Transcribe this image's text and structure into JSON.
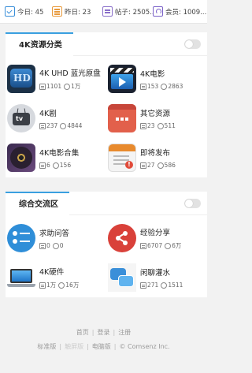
{
  "stats": {
    "today": "今日: 45",
    "yesterday": "昨日: 23",
    "posts": "帖子: 2505...",
    "members": "会员: 1009..."
  },
  "sections": [
    {
      "title": "4K资源分类",
      "items": [
        {
          "name": "4K UHD 蓝光原盘",
          "threads": "1101",
          "replies": "1万",
          "icon": "uhd-disc-icon"
        },
        {
          "name": "4K电影",
          "threads": "153",
          "replies": "2863",
          "icon": "clapperboard-icon"
        },
        {
          "name": "4K剧",
          "threads": "237",
          "replies": "4844",
          "icon": "tv-icon"
        },
        {
          "name": "其它资源",
          "threads": "23",
          "replies": "511",
          "icon": "more-icon"
        },
        {
          "name": "4K电影合集",
          "threads": "6",
          "replies": "156",
          "icon": "disc-icon"
        },
        {
          "name": "即将发布",
          "threads": "27",
          "replies": "586",
          "icon": "calendar-alert-icon"
        }
      ]
    },
    {
      "title": "综合交流区",
      "items": [
        {
          "name": "求助问答",
          "threads": "0",
          "replies": "0",
          "icon": "help-list-icon"
        },
        {
          "name": "经验分享",
          "threads": "6707",
          "replies": "6万",
          "icon": "share-icon"
        },
        {
          "name": "4K硬件",
          "threads": "1万",
          "replies": "16万",
          "icon": "laptop-icon"
        },
        {
          "name": "闲聊灌水",
          "threads": "271",
          "replies": "1511",
          "icon": "chat-icon"
        }
      ]
    }
  ],
  "footer": {
    "links": [
      "首页",
      "登录",
      "注册"
    ],
    "versions": [
      "标准版",
      "触屏版",
      "电脑版"
    ],
    "copyright": "© Comsenz Inc."
  }
}
